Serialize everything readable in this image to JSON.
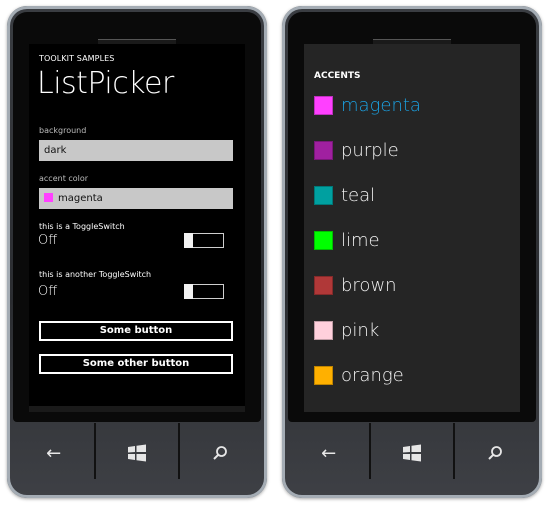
{
  "left_phone": {
    "app_title": "TOOLKIT SAMPLES",
    "page_title": "ListPicker",
    "background_picker": {
      "label": "background",
      "value": "dark"
    },
    "accent_picker": {
      "label": "accent color",
      "value": "magenta",
      "swatch_color": "#ff40ff"
    },
    "toggle1": {
      "label": "this is a ToggleSwitch",
      "state": "Off"
    },
    "toggle2": {
      "label": "this is another ToggleSwitch",
      "state": "Off"
    },
    "button1": "Some button",
    "button2": "Some other button"
  },
  "right_phone": {
    "title": "ACCENTS",
    "selected": "magenta",
    "accent_color": "#1ba1e2",
    "items": [
      {
        "label": "magenta",
        "color": "#ff40ff"
      },
      {
        "label": "purple",
        "color": "#a020a0"
      },
      {
        "label": "teal",
        "color": "#00a0a0"
      },
      {
        "label": "lime",
        "color": "#00ff00"
      },
      {
        "label": "brown",
        "color": "#b03838"
      },
      {
        "label": "pink",
        "color": "#ffd0dc"
      },
      {
        "label": "orange",
        "color": "#ffb000"
      }
    ]
  },
  "hardware_buttons": [
    {
      "name": "back",
      "glyph": "←"
    },
    {
      "name": "start",
      "glyph": "windows-logo"
    },
    {
      "name": "search",
      "glyph": "⚲"
    }
  ]
}
